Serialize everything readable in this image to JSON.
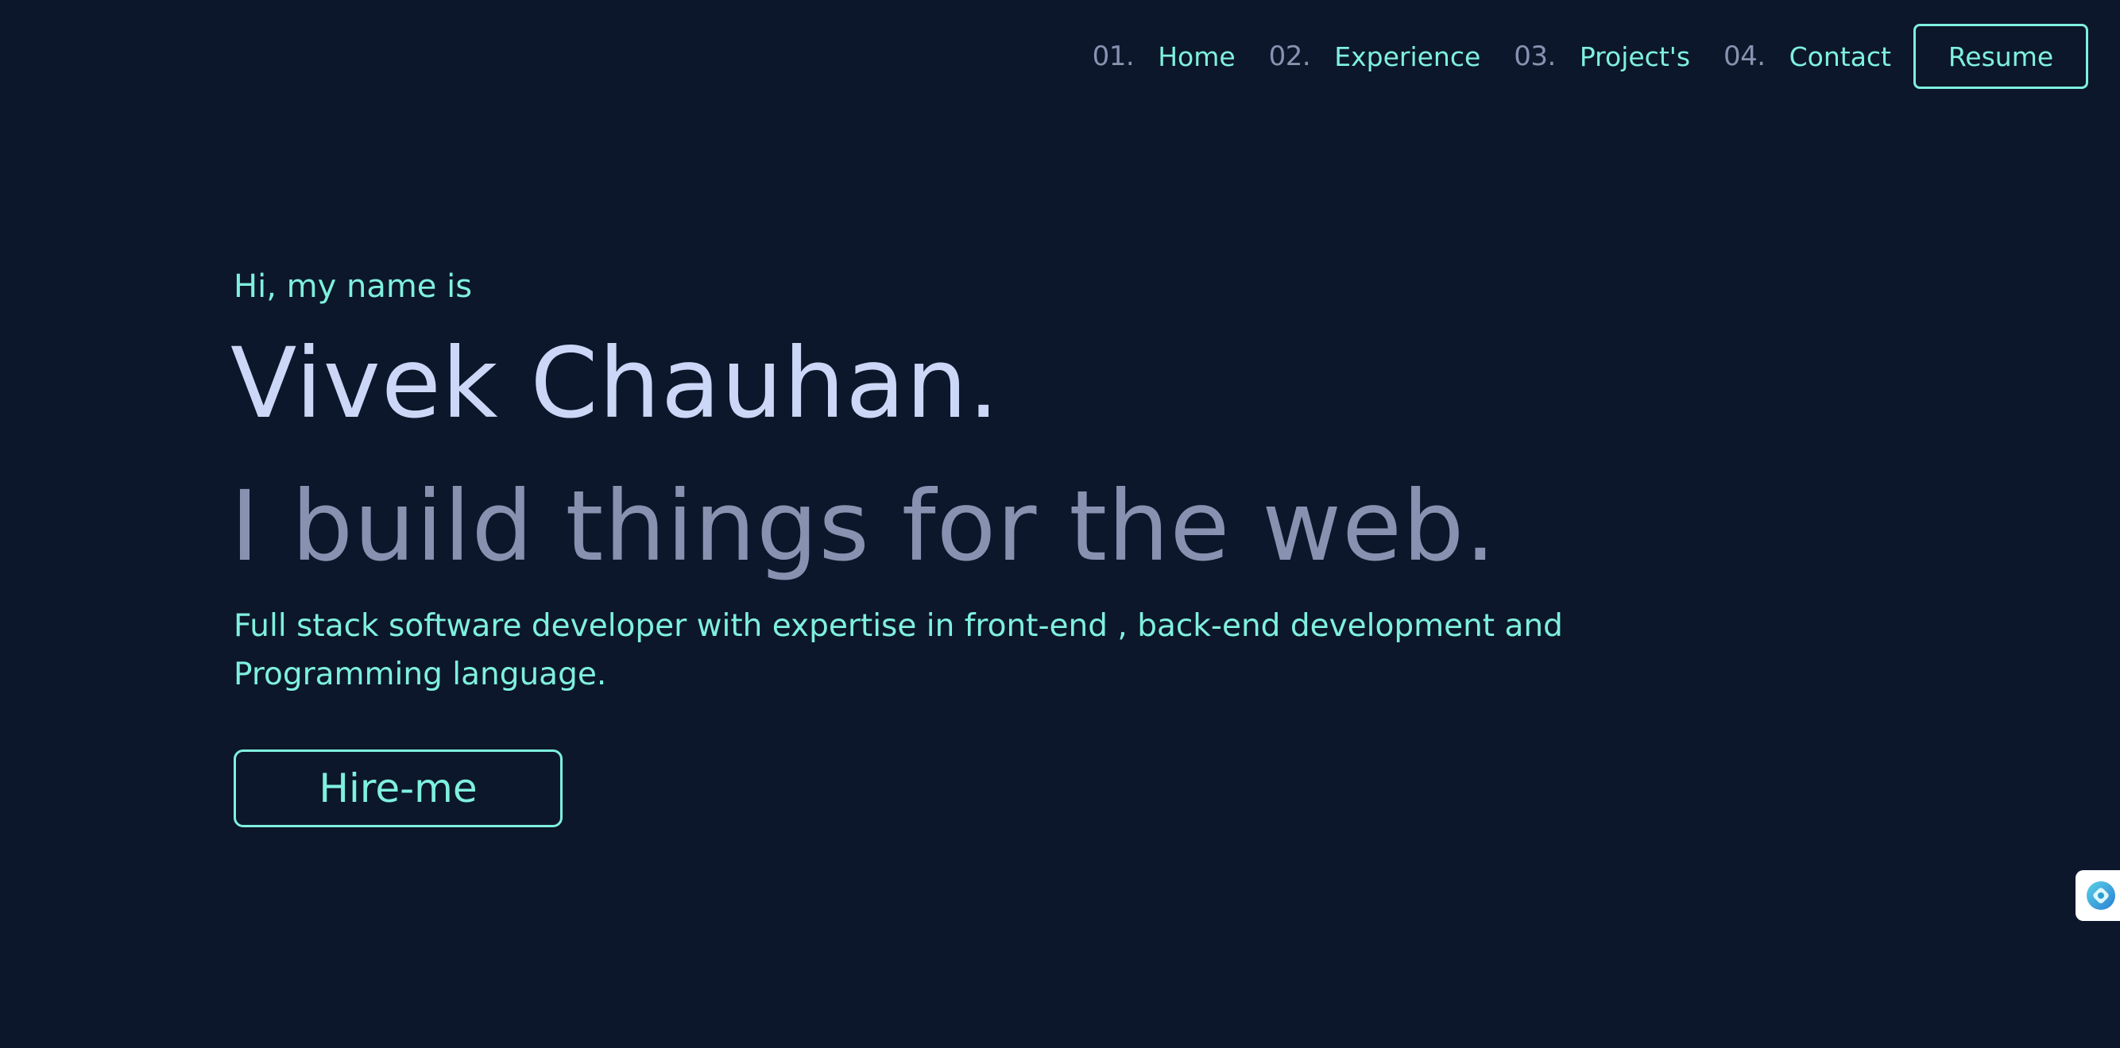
{
  "nav": {
    "items": [
      {
        "number": "01.",
        "label": "Home"
      },
      {
        "number": "02.",
        "label": "Experience"
      },
      {
        "number": "03.",
        "label": "Project's"
      },
      {
        "number": "04.",
        "label": "Contact"
      }
    ],
    "resume_label": "Resume"
  },
  "hero": {
    "greeting": "Hi, my name is",
    "name": "Vivek Chauhan.",
    "tagline": "I build things for the web.",
    "description": "Full stack software developer with expertise in front-end , back-end development and Programming language.",
    "hire_label": "Hire-me"
  },
  "widget": {
    "icon": "assistant-icon"
  },
  "colors": {
    "background": "#0c172b",
    "accent": "#7ff0e0",
    "heading": "#ccd6f6",
    "muted": "#8892b0"
  }
}
